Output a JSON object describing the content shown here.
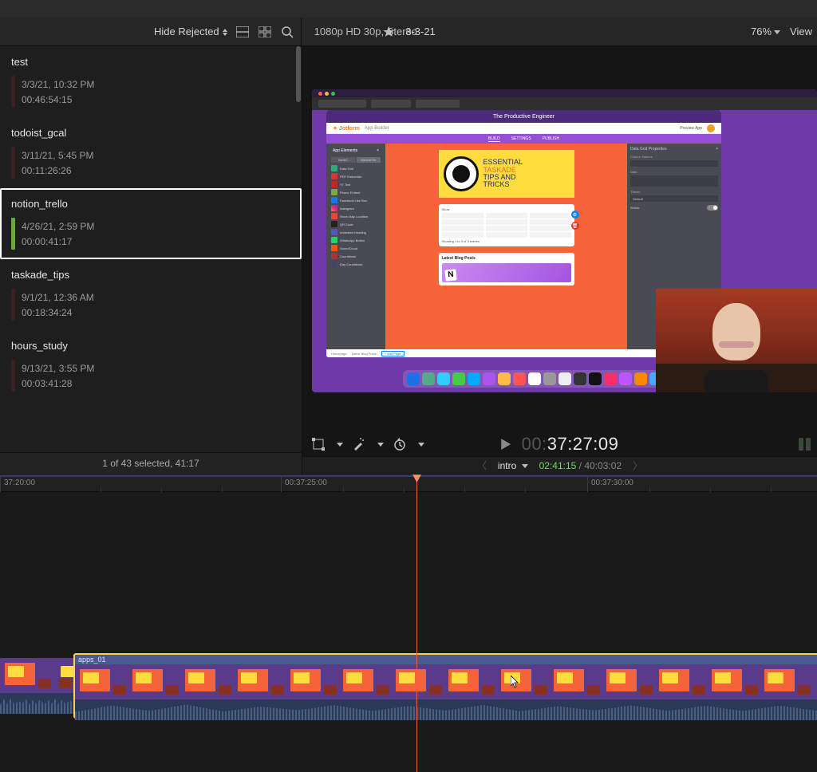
{
  "toolbar": {
    "hide_rejected": "Hide Rejected",
    "format": "1080p HD 30p, Stereo",
    "project": "3-3-21",
    "zoom": "76%",
    "view": "View"
  },
  "browser": {
    "events": [
      {
        "name": "test",
        "date": "3/3/21, 10:32 PM",
        "duration": "00:46:54:15"
      },
      {
        "name": "todoist_gcal",
        "date": "3/11/21, 5:45 PM",
        "duration": "00:11:26:26"
      },
      {
        "name": "notion_trello",
        "date": "4/26/21, 2:59 PM",
        "duration": "00:00:41:17",
        "selected": true
      },
      {
        "name": "taskade_tips",
        "date": "9/1/21, 12:36 AM",
        "duration": "00:18:34:24"
      },
      {
        "name": "hours_study",
        "date": "9/13/21, 3:55 PM",
        "duration": "00:03:41:28"
      }
    ],
    "status": "1 of 43 selected, 41:17"
  },
  "viewer": {
    "timecode_prefix": "00:",
    "timecode": "37:27:09",
    "index_name": "intro",
    "index_current": "02:41:15",
    "index_total": "40:03:02"
  },
  "preview": {
    "topbar": "The Productive Engineer",
    "logo": "Jotform",
    "logo_sub": "App Builder",
    "tabs": [
      "BUILD",
      "SETTINGS",
      "PUBLISH"
    ],
    "preview_app": "Preview App",
    "side_hd": "App Elements",
    "side_tabs": [
      "BASIC",
      "WIDGETS"
    ],
    "side_items": [
      "Data Grid",
      "PDF Embedder",
      "YT Text",
      "Phone Embed",
      "Facebook Like Box",
      "Instagram",
      "Show Map Location",
      "QR Code",
      "Animated Heading",
      "WhatsApp Button",
      "SoundCloud",
      "Countdown",
      "Day Countdown"
    ],
    "hero_l1": "ESSENTIAL",
    "hero_l2": "TASKADE",
    "hero_l3": "TIPS AND",
    "hero_l4": "TRICKS",
    "table_show": "Show",
    "table_footer": "Showing 1 to 3 of 3 entries",
    "posts_title": "Latest Blog Posts",
    "foot": [
      "Homepage",
      "Latest Blog Posts"
    ],
    "foot_add": "+ Add Page",
    "props_hd": "Data Grid Properties",
    "props": {
      "col": "Column Names",
      "data": "Data",
      "theme": "Theme",
      "theme_val": "Default",
      "shrink": "Shrink"
    }
  },
  "timeline": {
    "ticks": [
      "37:20:00",
      "00:37:25:00",
      "00:37:30:00"
    ],
    "clip_label": "apps_01"
  }
}
